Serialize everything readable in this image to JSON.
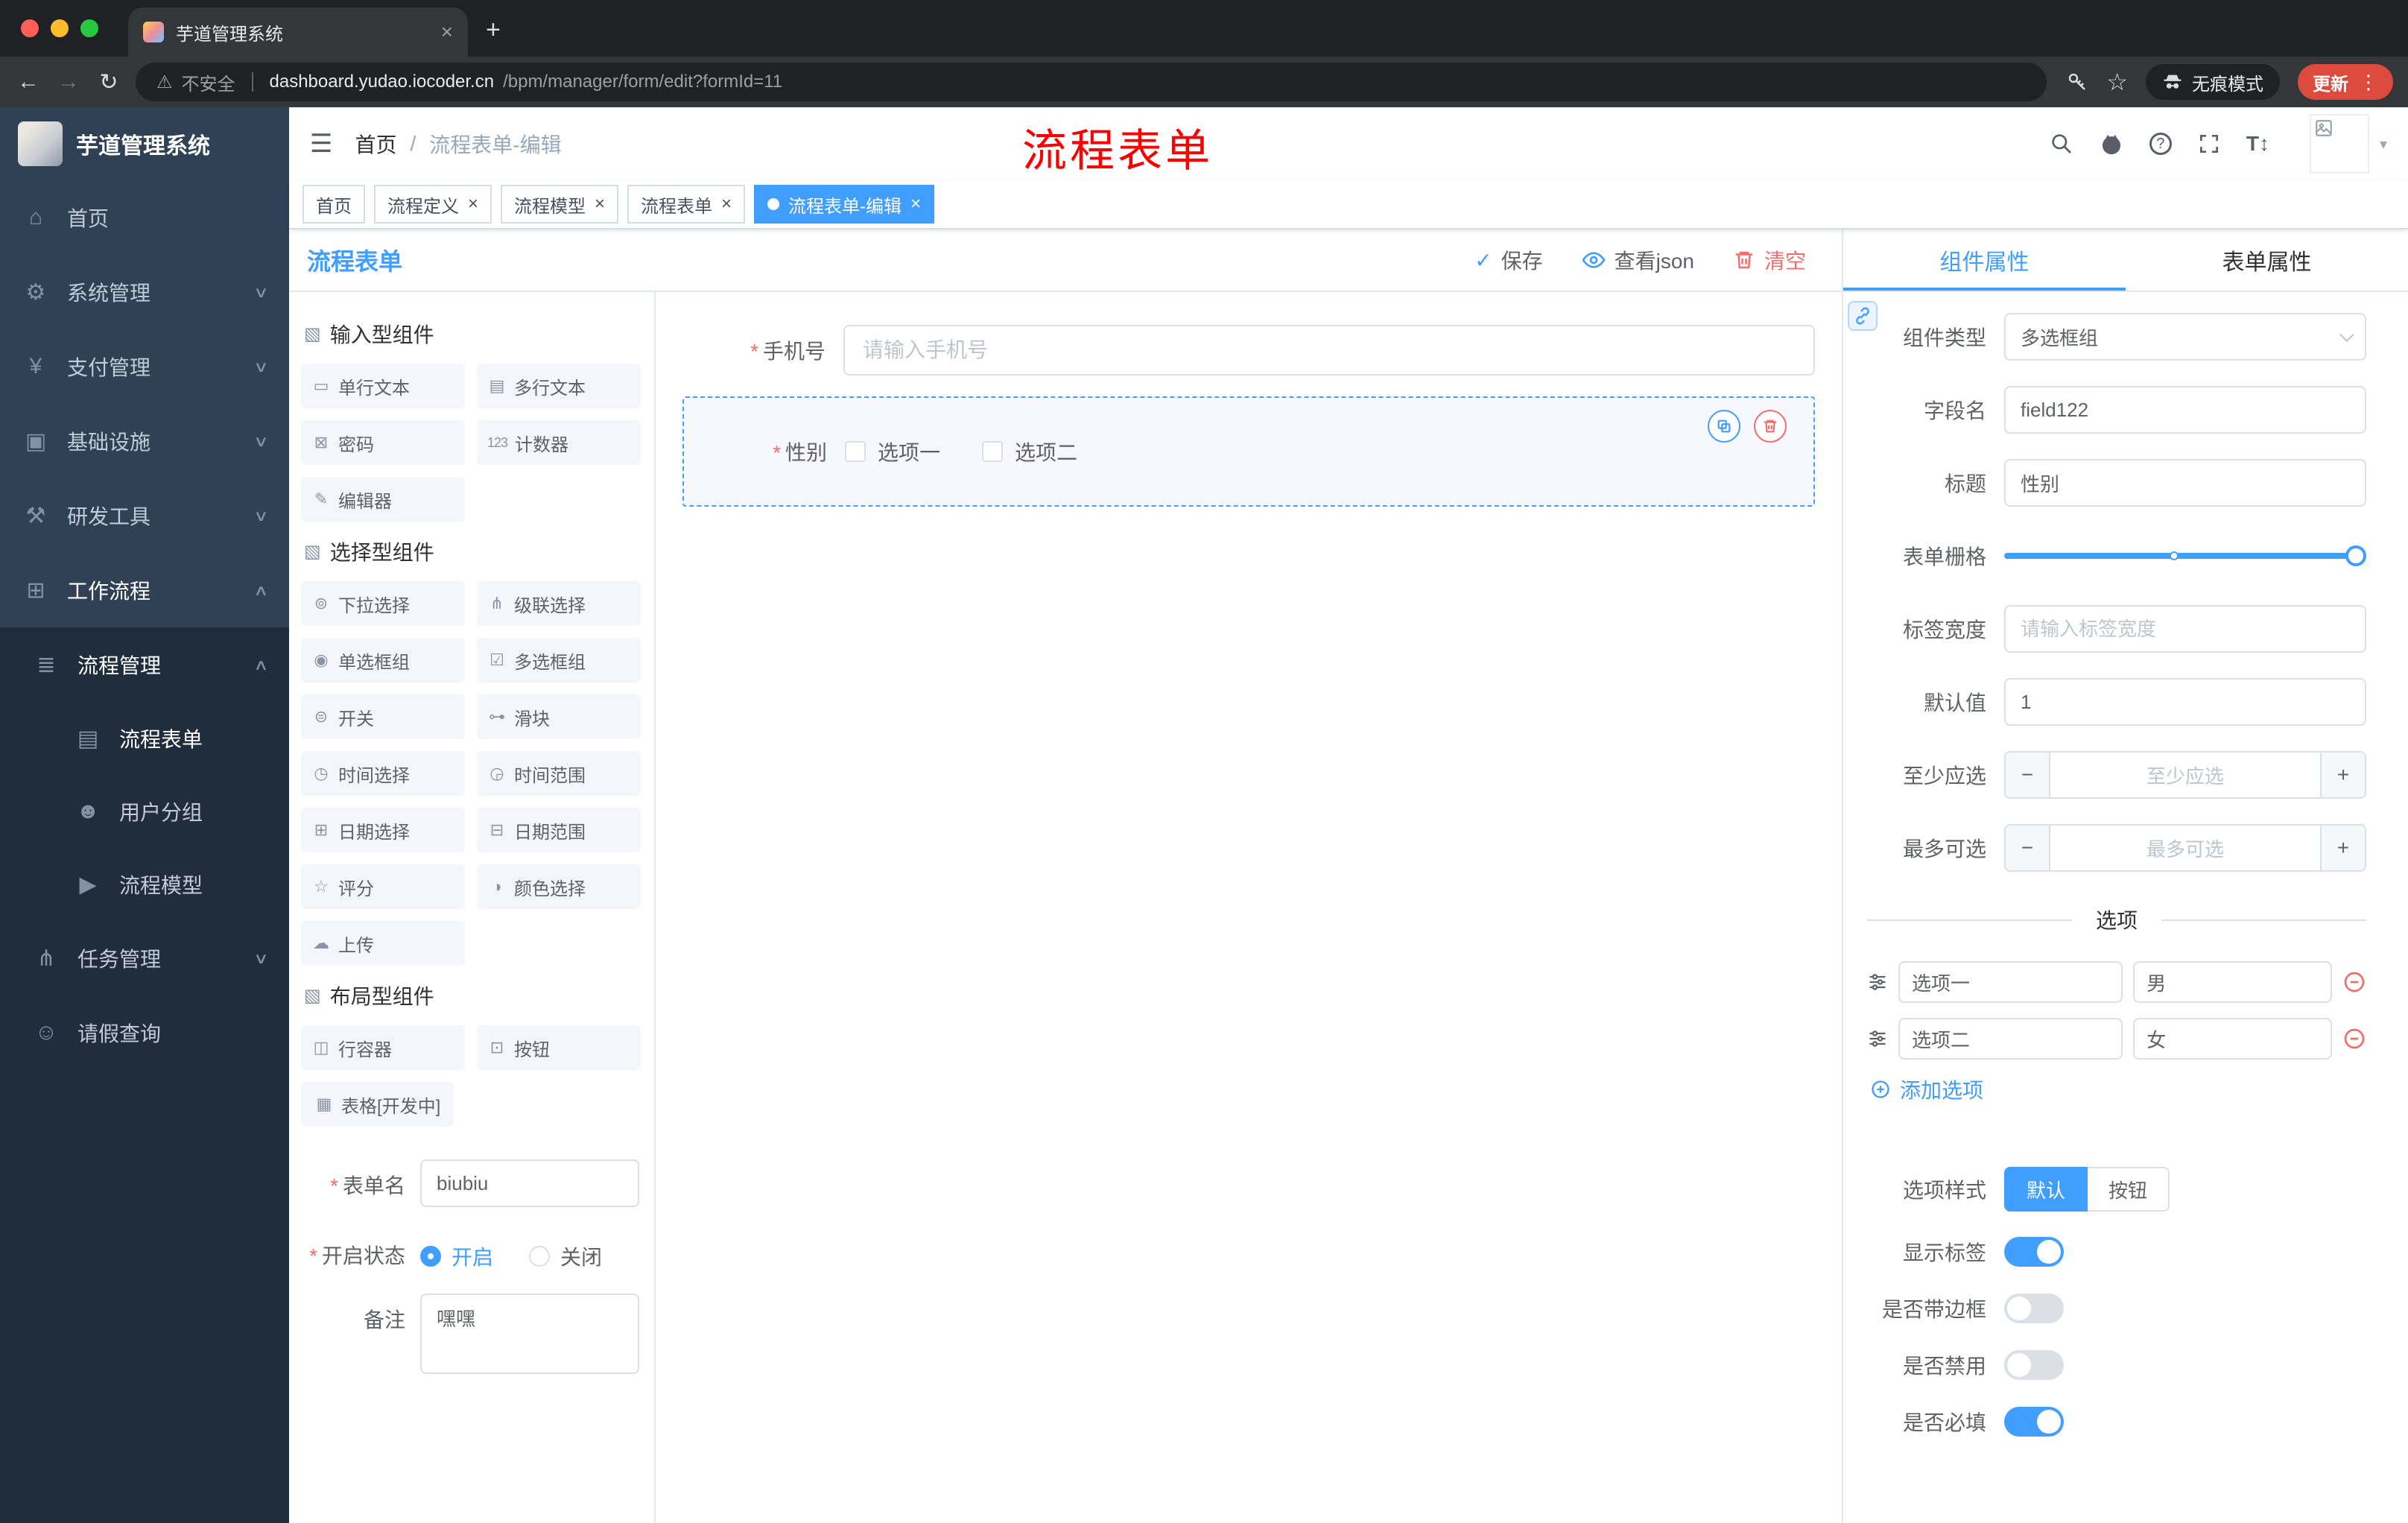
{
  "browser": {
    "tab_title": "芋道管理系统",
    "security": "不安全",
    "url_host": "dashboard.yudao.iocoder.cn",
    "url_path": "/bpm/manager/form/edit?formId=11",
    "incognito": "无痕模式",
    "update": "更新"
  },
  "ui": {
    "required": "*",
    "breadcrumb_sep": "/"
  },
  "colors": {
    "accent": "#409eff",
    "danger": "#f56c6c",
    "annotation": "#ff0000",
    "sidebar_bg": "#304156",
    "submenu_bg": "#1f2d3d"
  },
  "icons": {
    "hamburger": "☰",
    "home": "⌂",
    "gear": "⚙",
    "yen": "¥",
    "infra": "▣",
    "tools": "⚒",
    "workflow": "⊞",
    "list": "≣",
    "doc": "▤",
    "users": "☻",
    "send": "▶",
    "branch": "⋔",
    "person": "☺",
    "chevdown": "∨",
    "chevup": "∧",
    "caret": "▾",
    "warning": "⚠",
    "back": "←",
    "forward": "→",
    "reload": "↻",
    "newtab": "+",
    "close": "×",
    "kebab": "⋮",
    "star": "☆",
    "check": "✓",
    "question": "?",
    "tsize": "T↕",
    "cube": "▧",
    "singleline": "▭",
    "multiline": "▤",
    "password": "⊠",
    "counter": "123",
    "editor": "✎",
    "select": "⊚",
    "cascader": "⋔",
    "radiogroup": "◉",
    "checkboxgroup": "☑",
    "switch": "⊜",
    "slider": "⊶",
    "time": "◷",
    "timerange": "◶",
    "date": "⊞",
    "daterange": "⊟",
    "rate": "☆",
    "color": "◑",
    "upload": "☁",
    "row": "◫",
    "button": "⊡",
    "table": "▦",
    "minus": "−",
    "plus": "+"
  },
  "sidebar": {
    "logo": "芋道管理系统",
    "items": [
      {
        "label": "首页"
      },
      {
        "label": "系统管理"
      },
      {
        "label": "支付管理"
      },
      {
        "label": "基础设施"
      },
      {
        "label": "研发工具"
      },
      {
        "label": "工作流程"
      }
    ],
    "submenu": {
      "process": "流程管理",
      "children": [
        "流程表单",
        "用户分组",
        "流程模型"
      ],
      "task": "任务管理",
      "leave": "请假查询"
    }
  },
  "header": {
    "breadcrumb": [
      "首页",
      "流程表单-编辑"
    ],
    "annotation": "流程表单"
  },
  "tags": [
    "首页",
    "流程定义",
    "流程模型",
    "流程表单",
    "流程表单-编辑"
  ],
  "designer": {
    "title": "流程表单",
    "toolbar": {
      "save": "保存",
      "view_json": "查看json",
      "clear": "清空"
    },
    "groups": [
      {
        "title": "输入型组件",
        "items": [
          "单行文本",
          "多行文本",
          "密码",
          "计数器",
          "编辑器"
        ]
      },
      {
        "title": "选择型组件",
        "items": [
          "下拉选择",
          "级联选择",
          "单选框组",
          "多选框组",
          "开关",
          "滑块",
          "时间选择",
          "时间范围",
          "日期选择",
          "日期范围",
          "评分",
          "颜色选择",
          "上传"
        ]
      },
      {
        "title": "布局型组件",
        "items": [
          "行容器",
          "按钮",
          "表格[开发中]"
        ]
      }
    ],
    "form": {
      "name_label": "表单名",
      "name_value": "biubiu",
      "status_label": "开启状态",
      "status_on": "开启",
      "status_off": "关闭",
      "remark_label": "备注",
      "remark_value": "嘿嘿"
    }
  },
  "canvas": {
    "phone_label": "手机号",
    "phone_placeholder": "请输入手机号",
    "gender_label": "性别",
    "gender_options": [
      "选项一",
      "选项二"
    ]
  },
  "props": {
    "tabs": [
      "组件属性",
      "表单属性"
    ],
    "type_label": "组件类型",
    "type_value": "多选框组",
    "field_label": "字段名",
    "field_value": "field122",
    "title_label": "标题",
    "title_value": "性别",
    "grid_label": "表单栅格",
    "width_label": "标签宽度",
    "width_placeholder": "请输入标签宽度",
    "default_label": "默认值",
    "default_value": "1",
    "min_label": "至少应选",
    "min_placeholder": "至少应选",
    "max_label": "最多可选",
    "max_placeholder": "最多可选",
    "options_title": "选项",
    "options": [
      {
        "label": "选项一",
        "value": "男"
      },
      {
        "label": "选项二",
        "value": "女"
      }
    ],
    "add_option": "添加选项",
    "style_label": "选项样式",
    "style_default": "默认",
    "style_button": "按钮",
    "toggle_show_label": "显示标签",
    "toggle_border": "是否带边框",
    "toggle_disabled": "是否禁用",
    "toggle_required": "是否必填"
  }
}
